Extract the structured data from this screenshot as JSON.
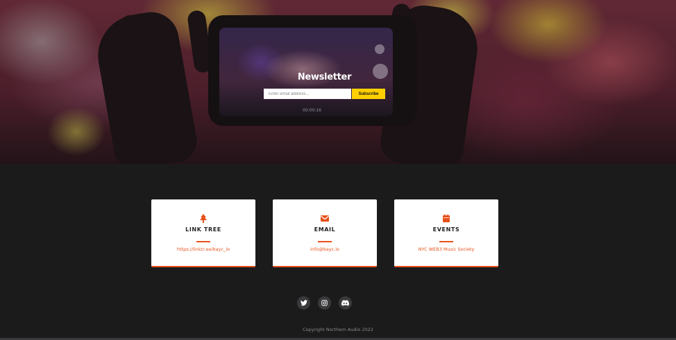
{
  "newsletter": {
    "title": "Newsletter",
    "email_placeholder": "Enter email address...",
    "email_value": "",
    "subscribe_label": "Subscribe"
  },
  "hero_phone": {
    "timer": "00:00:16"
  },
  "cards": [
    {
      "icon": "tree-icon",
      "title": "LINK TREE",
      "link": "https://linktr.ee/bayc_io"
    },
    {
      "icon": "envelope-icon",
      "title": "EMAIL",
      "link": "info@bayc.io"
    },
    {
      "icon": "calendar-icon",
      "title": "EVENTS",
      "link": "NYC WEB3 Music Society"
    }
  ],
  "social": [
    {
      "icon": "twitter-icon"
    },
    {
      "icon": "instagram-icon"
    },
    {
      "icon": "discord-icon"
    }
  ],
  "footer": {
    "copyright": "Copyright Northern Audio 2022"
  },
  "colors": {
    "accent": "#e8501a",
    "subscribe": "#ffd000",
    "background": "#1c1b1c",
    "card": "#ffffff"
  }
}
